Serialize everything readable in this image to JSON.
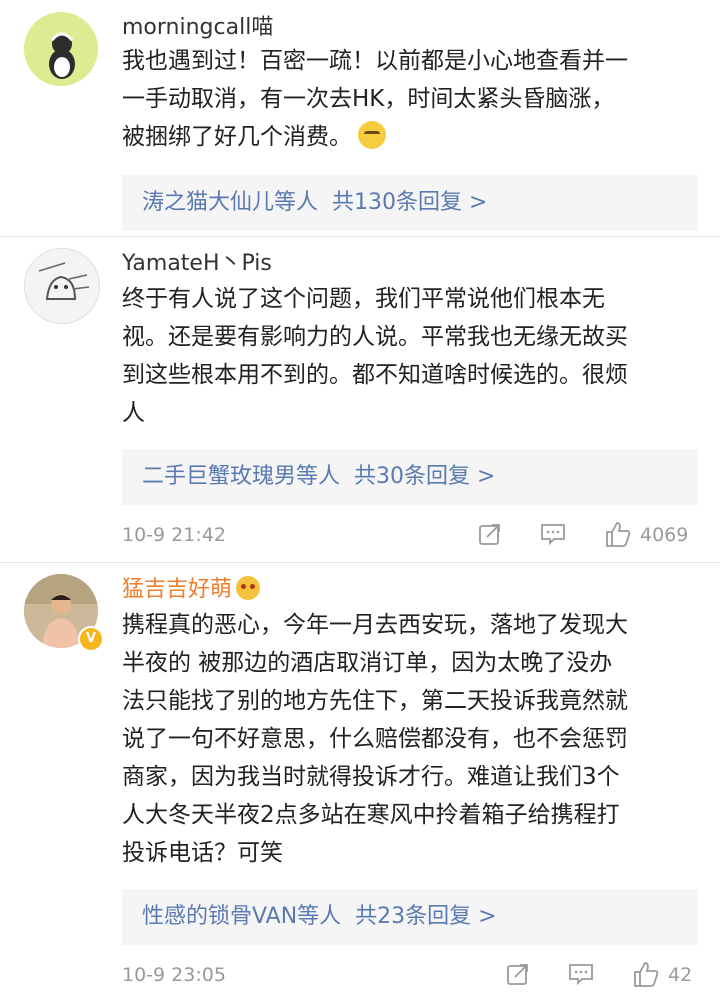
{
  "comments": [
    {
      "name": "morningcall喵",
      "lines": [
        "我也遇到过！百密一疏！以前都是小心地查看并一",
        "一手动取消，有一次去HK，时间太紧头昏脑涨，",
        "被捆绑了好几个消费。"
      ],
      "replies": {
        "who": "涛之猫大仙儿",
        "mid": "等人",
        "count": "共130条回复 >"
      }
    },
    {
      "name": "YamateH丶Pis",
      "lines": [
        "终于有人说了这个问题，我们平常说他们根本无",
        "视。还是要有影响力的人说。平常我也无缘无故买",
        "到这些根本用不到的。都不知道啥时候选的。很烦",
        "人"
      ],
      "replies": {
        "who": "二手巨蟹玫瑰男",
        "mid": "等人",
        "count": "共30条回复 >"
      },
      "time": "10-9 21:42",
      "likes": "4069"
    },
    {
      "name": "猛吉吉好萌",
      "lines": [
        "携程真的恶心，今年一月去西安玩，落地了发现大",
        "半夜的 被那边的酒店取消订单，因为太晚了没办",
        "法只能找了别的地方先住下，第二天投诉我竟然就",
        "说了一句不好意思，什么赔偿都没有，也不会惩罚",
        "商家，因为我当时就得投诉才行。难道让我们3个",
        "人大冬天半夜2点多站在寒风中拎着箱子给携程打",
        "投诉电话？可笑"
      ],
      "replies": {
        "who": "性感的锁骨VAN",
        "mid": "等人",
        "count": "共23条回复 >"
      },
      "time": "10-9 23:05",
      "likes": "42"
    }
  ],
  "colors": {
    "link": "#5b7ab2",
    "vip_name": "#f07d2c",
    "meta": "#9a9a9a"
  },
  "icons": [
    "share-icon",
    "comment-icon",
    "like-icon"
  ]
}
